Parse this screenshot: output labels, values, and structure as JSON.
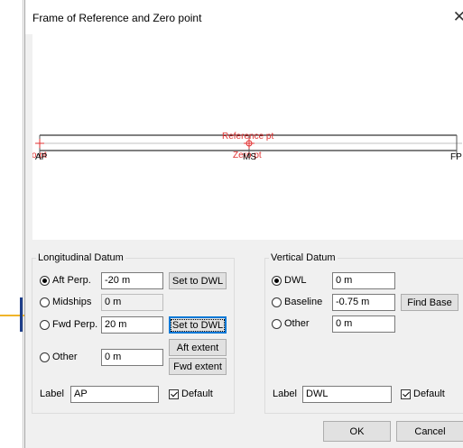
{
  "dialog": {
    "title": "Frame of Reference and Zero point",
    "close_glyph": "✕"
  },
  "preview": {
    "reference_label": "Reference pt",
    "zero_label": "Zero pt",
    "aft_label": "AP",
    "aft_zero_label": "Zero pt",
    "mid_label": "MS",
    "fwd_label": "FP",
    "hull_color": "#000000",
    "marker_color": "#e03030"
  },
  "longitudinal": {
    "legend": "Longitudinal Datum",
    "aft_perp": {
      "label": "Aft Perp.",
      "value": "-20 m",
      "button": "Set to DWL",
      "selected": true
    },
    "midships": {
      "label": "Midships",
      "value": "0 m",
      "selected": false
    },
    "fwd_perp": {
      "label": "Fwd Perp.",
      "value": "20 m",
      "button": "Set to DWL",
      "selected": false
    },
    "other": {
      "label": "Other",
      "value": "0 m",
      "aft_button": "Aft extent",
      "fwd_button": "Fwd extent",
      "selected": false
    },
    "label_caption": "Label",
    "label_value": "AP",
    "default_label": "Default",
    "default_checked": true
  },
  "vertical": {
    "legend": "Vertical Datum",
    "dwl": {
      "label": "DWL",
      "value": "0 m",
      "selected": true
    },
    "baseline": {
      "label": "Baseline",
      "value": "-0.75 m",
      "button": "Find Base",
      "selected": false
    },
    "other": {
      "label": "Other",
      "value": "0 m",
      "selected": false
    },
    "label_caption": "Label",
    "label_value": "DWL",
    "default_label": "Default",
    "default_checked": true
  },
  "footer": {
    "ok": "OK",
    "cancel": "Cancel"
  }
}
